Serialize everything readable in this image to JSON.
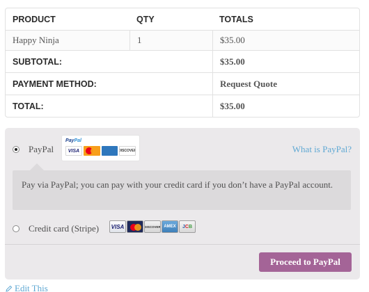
{
  "order": {
    "headers": {
      "product": "PRODUCT",
      "qty": "QTY",
      "totals": "TOTALS"
    },
    "item": {
      "name": "Happy Ninja",
      "qty": "1",
      "total": "$35.00"
    },
    "subtotal": {
      "label": "SUBTOTAL:",
      "value": "$35.00"
    },
    "payment_method": {
      "label": "PAYMENT METHOD:",
      "value": "Request Quote"
    },
    "total": {
      "label": "TOTAL:",
      "value": "$35.00"
    }
  },
  "payment": {
    "paypal": {
      "label": "PayPal",
      "selected": true,
      "mark_text_pay": "Pay",
      "mark_text_pal": "Pal",
      "mark_cards": [
        "VISA",
        "mastercard",
        "AMEX",
        "DISCOVER"
      ],
      "what_link": "What is PayPal?",
      "description": "Pay via PayPal; you can pay with your credit card if you don’t have a PayPal ac­count."
    },
    "stripe": {
      "label": "Credit card (Stripe)",
      "selected": false,
      "cards": [
        "VISA",
        "mastercard",
        "DISCOVER",
        "AMEX",
        "JCB"
      ]
    },
    "proceed_button": "Proceed to PayPal"
  },
  "edit_link": "Edit This",
  "colors": {
    "accent": "#a46497",
    "link": "#5fa8d3",
    "payment_bg": "#ebe9eb",
    "description_bg": "#dcdadc"
  }
}
